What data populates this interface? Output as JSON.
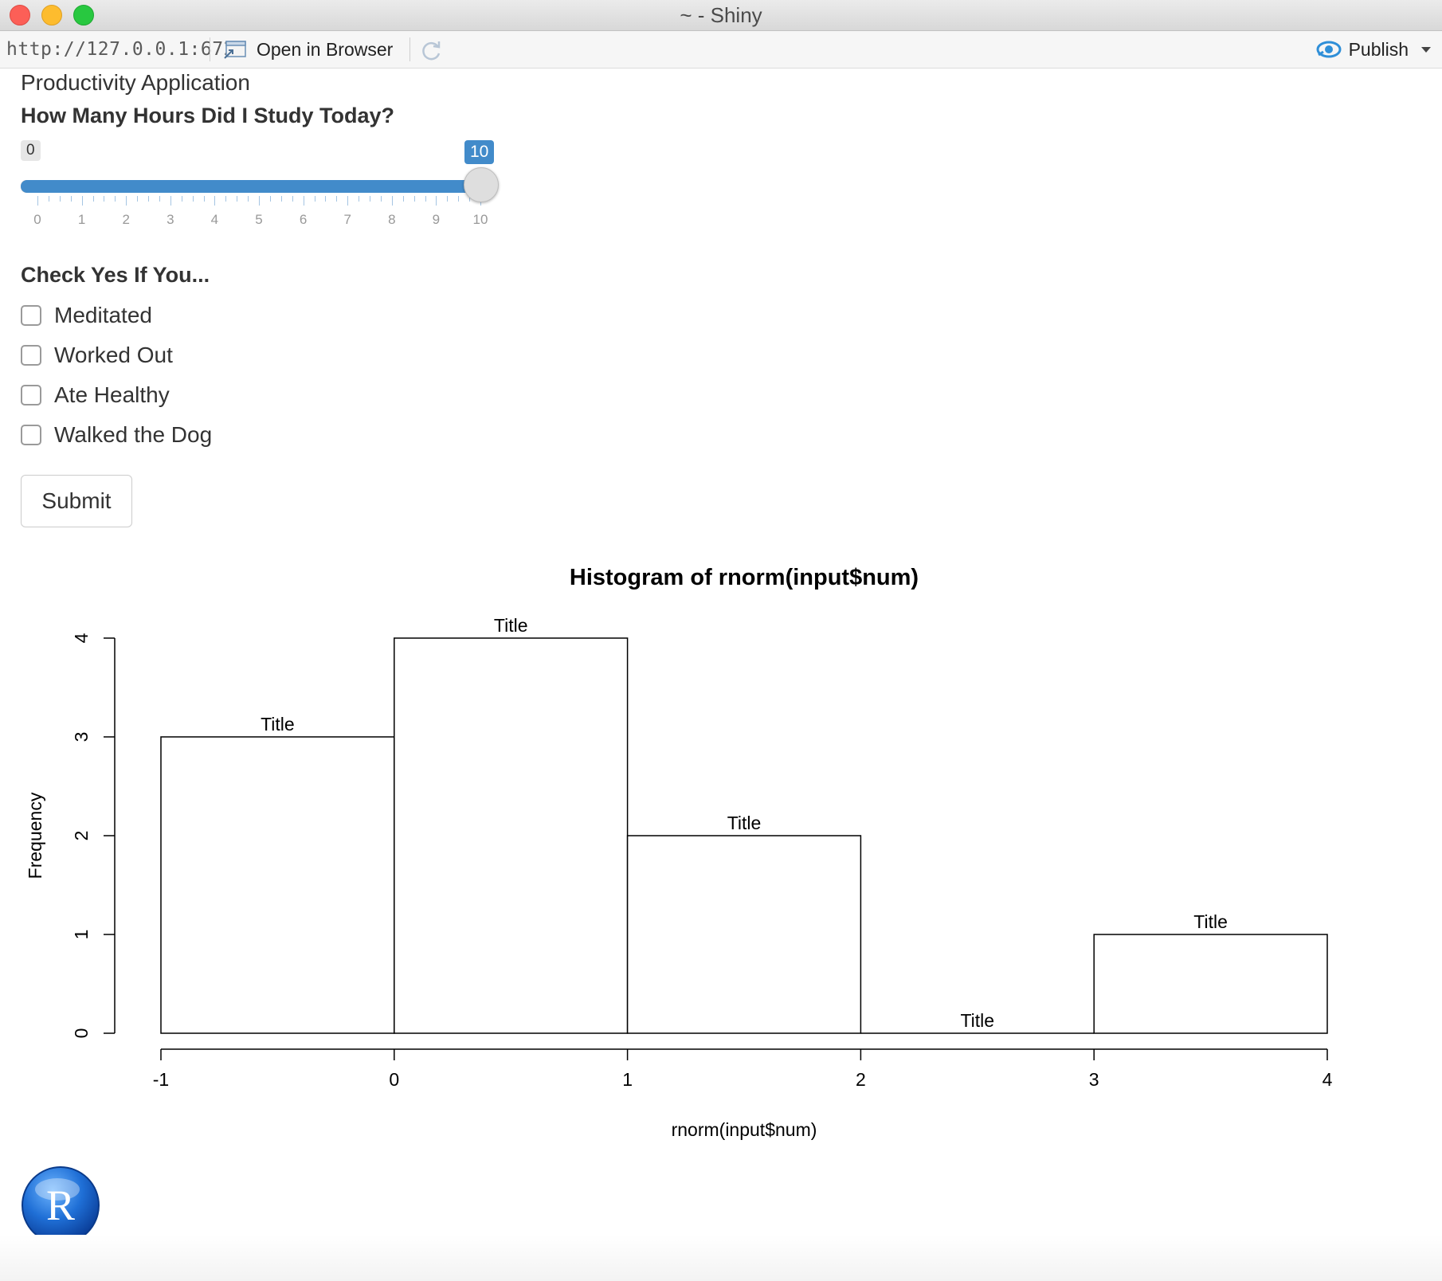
{
  "window": {
    "title": "~ - Shiny"
  },
  "toolbar": {
    "url": "http://127.0.0.1:6720",
    "open_in_browser": "Open in Browser",
    "publish": "Publish"
  },
  "app": {
    "title": "Productivity Application",
    "slider": {
      "label": "How Many Hours Did I Study Today?",
      "min": 0,
      "max": 10,
      "value": 10,
      "min_label": "0",
      "value_label": "10",
      "ticks": [
        "0",
        "1",
        "2",
        "3",
        "4",
        "5",
        "6",
        "7",
        "8",
        "9",
        "10"
      ],
      "accent": "#428bca"
    },
    "checkbox_group": {
      "label": "Check Yes If You...",
      "options": [
        {
          "label": "Meditated",
          "checked": false
        },
        {
          "label": "Worked Out",
          "checked": false
        },
        {
          "label": "Ate Healthy",
          "checked": false
        },
        {
          "label": "Walked the Dog",
          "checked": false
        }
      ]
    },
    "submit_label": "Submit"
  },
  "chart_data": {
    "type": "bar",
    "title": "Histogram of rnorm(input$num)",
    "xlabel": "rnorm(input$num)",
    "ylabel": "Frequency",
    "bins": [
      {
        "from": -1,
        "to": 0,
        "count": 3,
        "label": "Title"
      },
      {
        "from": 0,
        "to": 1,
        "count": 4,
        "label": "Title"
      },
      {
        "from": 1,
        "to": 2,
        "count": 2,
        "label": "Title"
      },
      {
        "from": 2,
        "to": 3,
        "count": 0,
        "label": "Title"
      },
      {
        "from": 3,
        "to": 4,
        "count": 1,
        "label": "Title"
      }
    ],
    "xlim": [
      -1,
      4
    ],
    "ylim": [
      0,
      4
    ],
    "xticks": [
      "-1",
      "0",
      "1",
      "2",
      "3",
      "4"
    ],
    "yticks": [
      "0",
      "1",
      "2",
      "3",
      "4"
    ],
    "grid": false
  },
  "icons": {
    "refresh": "refresh-icon",
    "open_browser": "open-browser-icon",
    "publish": "publish-icon",
    "r_logo": "R"
  }
}
